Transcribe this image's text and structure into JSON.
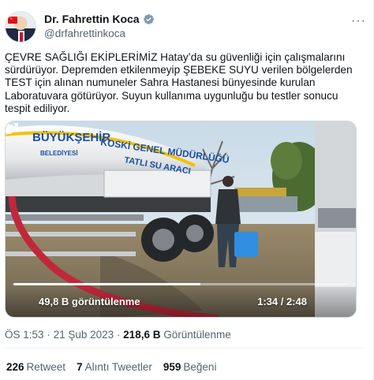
{
  "author": {
    "display_name": "Dr. Fahrettin Koca",
    "handle": "@drfahrettinkoca",
    "verified": true
  },
  "tweet": {
    "text": "ÇEVRE SAĞLIĞI EKİPLERİMİZ Hatay’da su güvenliği için çalışmalarını sürdürüyor. Depremden etkilenmeyip ŞEBEKE SUYU verilen bölgelerden TEST için alınan numuneler Sahra Hastanesi bünyesinde kurulan Laboratuvara götürüyor. Suyun kullanıma uygunluğu bu testler sonucu tespit ediliyor."
  },
  "video": {
    "views_label": "49,8 B görüntülenme",
    "time_label": "1:34 / 2:48",
    "progress_fraction": 0.56,
    "truck_lines": [
      "BÜYÜKŞEHİR",
      "BELEDİYESİ",
      "KOSKİ GENEL MÜDÜRLÜĞÜ",
      "TATLI SU ARACI"
    ]
  },
  "meta": {
    "time": "ÖS 1:53",
    "separator": "·",
    "date": "21 Şub 2023",
    "views_count": "218,6 B",
    "views_label": "Görüntülenme"
  },
  "stats": [
    {
      "count": "226",
      "label": "Retweet"
    },
    {
      "count": "7",
      "label": "Alıntı Tweetler"
    },
    {
      "count": "959",
      "label": "Beğeni"
    }
  ],
  "colors": {
    "verified_badge": "#829aab",
    "text_secondary": "#536471",
    "truck_blue": "#1a4ea3",
    "truck_yellow": "#f2c200",
    "hose_red": "#c0283a"
  }
}
